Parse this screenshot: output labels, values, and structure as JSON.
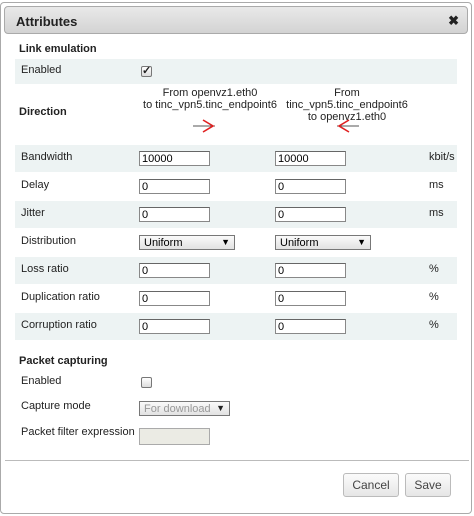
{
  "dialog": {
    "title": "Attributes",
    "close_glyph": "✖"
  },
  "link_emulation": {
    "heading": "Link emulation",
    "enabled_label": "Enabled",
    "enabled": true,
    "direction_heading": "Direction",
    "dir1_line1": "From openvz1.eth0",
    "dir1_line2": "to tinc_vpn5.tinc_endpoint6",
    "dir2_line1": "From tinc_vpn5.tinc_endpoint6",
    "dir2_line2": "to openvz1.eth0",
    "rows": {
      "bandwidth": {
        "label": "Bandwidth",
        "v1": "10000",
        "v2": "10000",
        "unit": "kbit/s"
      },
      "delay": {
        "label": "Delay",
        "v1": "0",
        "v2": "0",
        "unit": "ms"
      },
      "jitter": {
        "label": "Jitter",
        "v1": "0",
        "v2": "0",
        "unit": "ms"
      },
      "distribution": {
        "label": "Distribution",
        "v1": "Uniform",
        "v2": "Uniform"
      },
      "loss": {
        "label": "Loss ratio",
        "v1": "0",
        "v2": "0",
        "unit": "%"
      },
      "duplication": {
        "label": "Duplication ratio",
        "v1": "0",
        "v2": "0",
        "unit": "%"
      },
      "corruption": {
        "label": "Corruption ratio",
        "v1": "0",
        "v2": "0",
        "unit": "%"
      }
    }
  },
  "packet_capturing": {
    "heading": "Packet capturing",
    "enabled_label": "Enabled",
    "enabled": false,
    "capture_mode_label": "Capture mode",
    "capture_mode_value": "For download",
    "filter_label": "Packet filter expression",
    "filter_value": ""
  },
  "buttons": {
    "cancel": "Cancel",
    "save": "Save"
  },
  "colors": {
    "arrow": "#e02020",
    "row_shade": "#edf3f3"
  }
}
